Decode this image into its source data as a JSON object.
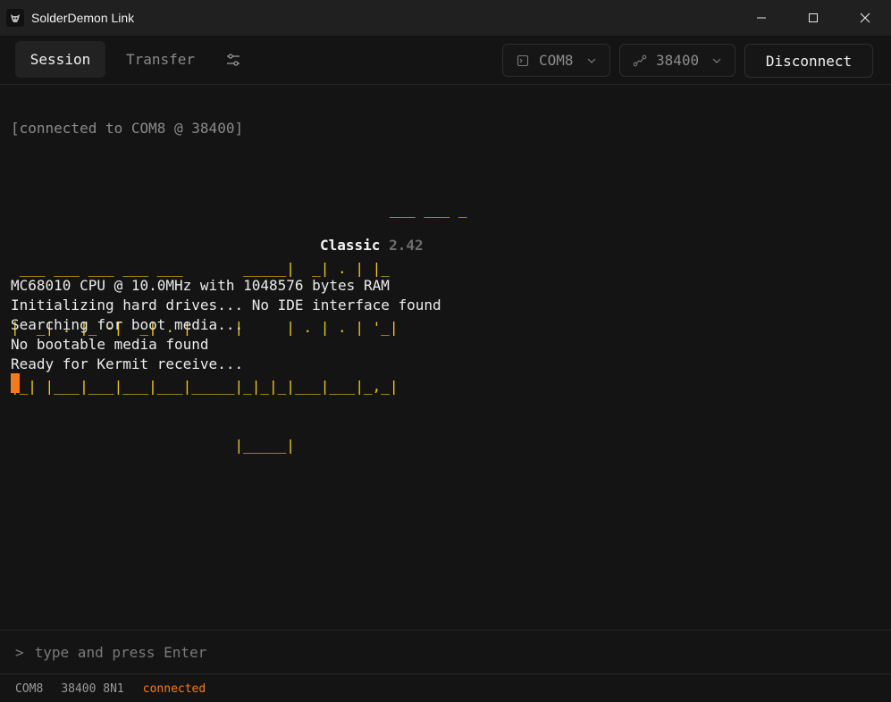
{
  "window": {
    "title": "SolderDemon Link"
  },
  "toolbar": {
    "tab_session": "Session",
    "tab_transfer": "Transfer",
    "port_value": "COM8",
    "baud_value": "38400",
    "disconnect_label": "Disconnect"
  },
  "terminal": {
    "connect_line": "[connected to COM8 @ 38400]",
    "logo_lines": [
      "                                            ___ ___ _",
      " ___ ___ ___ ___ ___       _____|  _| . | |_",
      "|  _| . |_ -|  _| . |     |     | . | . | '_|",
      "|_| |___|___|___|___|_____|_|_|_|___|___|_,_|",
      "                          |_____|"
    ],
    "edition": "Classic",
    "version": "2.42",
    "boot_lines": [
      "MC68010 CPU @ 10.0MHz with 1048576 bytes RAM",
      "Initializing hard drives... No IDE interface found",
      "Searching for boot media...",
      "No bootable media found",
      "Ready for Kermit receive..."
    ]
  },
  "input": {
    "prompt": ">",
    "placeholder": "type and press Enter"
  },
  "status": {
    "port": "COM8",
    "config": "38400 8N1",
    "state": "connected"
  },
  "colors": {
    "accent": "#f57c1a",
    "logo": "#f2c619"
  }
}
